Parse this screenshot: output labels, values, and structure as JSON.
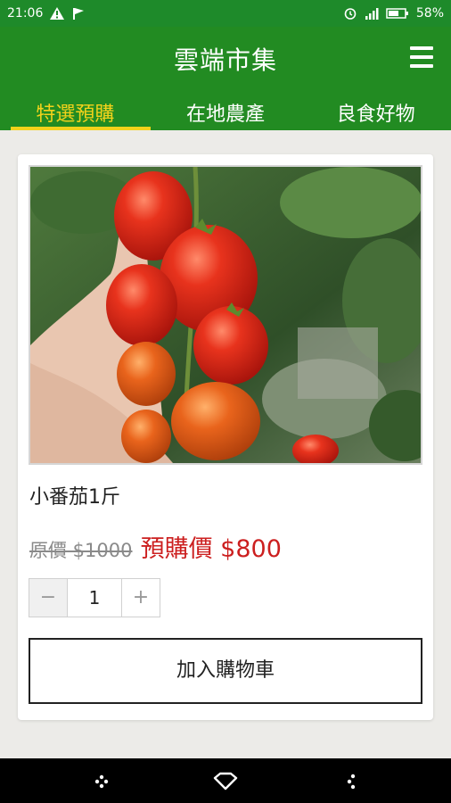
{
  "status_bar": {
    "time": "21:06",
    "battery_percent": "58%",
    "icons_left": [
      "warning-icon",
      "flag-icon"
    ],
    "icons_right": [
      "alarm-icon",
      "signal-icon",
      "battery-icon"
    ]
  },
  "app_bar": {
    "title": "雲端市集",
    "menu_icon": "hamburger-menu-icon"
  },
  "tabs": [
    {
      "label": "特選預購",
      "active": true
    },
    {
      "label": "在地農產",
      "active": false
    },
    {
      "label": "良食好物",
      "active": false
    }
  ],
  "product": {
    "image": "cherry-tomatoes-photo",
    "name": "小番茄1斤",
    "original_price_text": "原價 $1000",
    "preorder_price_text": "預購價 $800",
    "quantity": "1",
    "minus_label": "−",
    "plus_label": "+",
    "add_to_cart_label": "加入購物車"
  },
  "nav_bar": {
    "buttons": [
      "back-icon",
      "home-icon",
      "recent-apps-icon"
    ]
  },
  "colors": {
    "primary_green": "#228b22",
    "tab_active": "#f3d21b",
    "price_red": "#cc1f1f"
  }
}
